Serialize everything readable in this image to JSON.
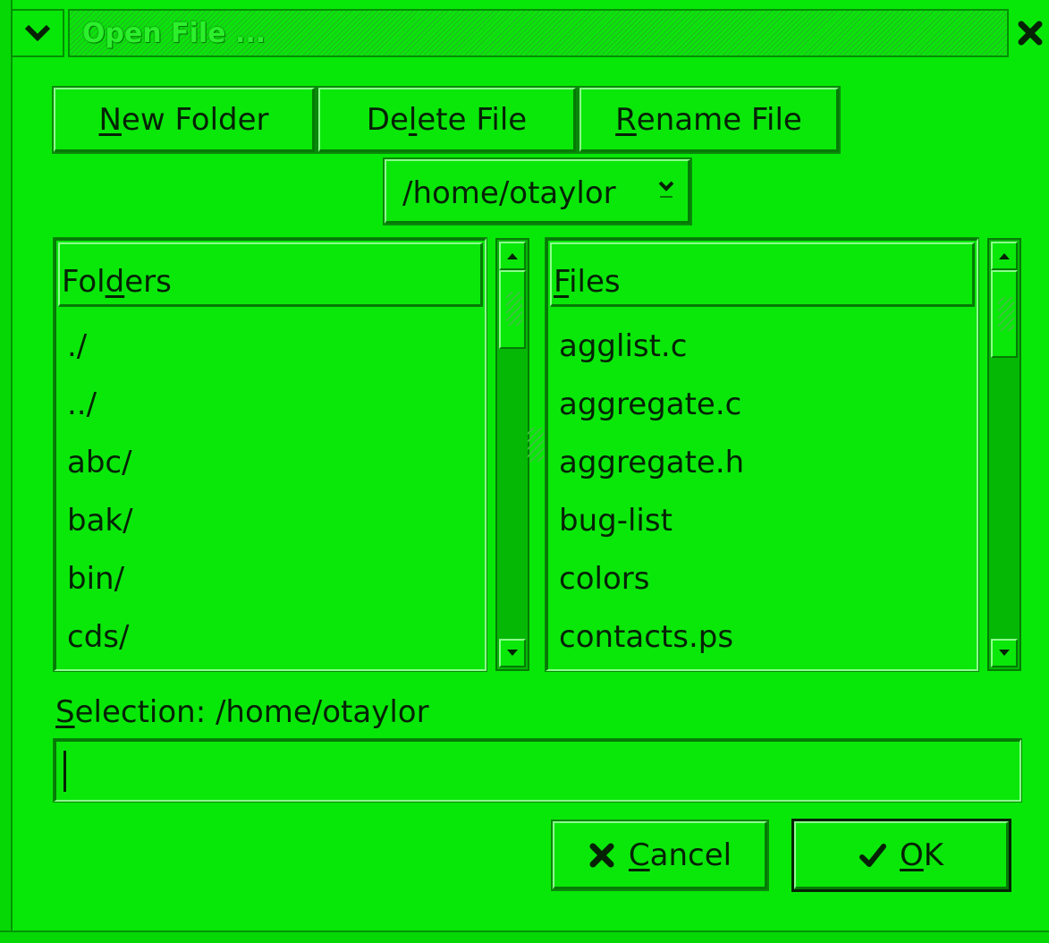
{
  "window": {
    "title": "Open File ...",
    "menu_icon": "chevron-down-icon",
    "close_icon": "close-x-icon"
  },
  "toolbar": {
    "new_folder_underline": "N",
    "new_folder_rest": "ew Folder",
    "delete_file_pre": "De",
    "delete_file_underline": "l",
    "delete_file_rest": "ete File",
    "rename_file_underline": "R",
    "rename_file_rest": "ename File"
  },
  "path": {
    "current": "/home/otaylor"
  },
  "folders": {
    "header_pre": "Fol",
    "header_underline": "d",
    "header_rest": "ers",
    "items": [
      "./",
      "../",
      "abc/",
      "bak/",
      "bin/",
      "cds/"
    ]
  },
  "files": {
    "header_underline": "F",
    "header_rest": "iles",
    "items": [
      "agglist.c",
      "aggregate.c",
      "aggregate.h",
      "bug-list",
      "colors",
      "contacts.ps"
    ]
  },
  "selection": {
    "label_underline": "S",
    "label_rest": "election: /home/otaylor",
    "value": ""
  },
  "actions": {
    "cancel_underline": "C",
    "cancel_rest": "ancel",
    "ok_underline": "O",
    "ok_rest": "K"
  },
  "colors": {
    "background": "#0ae80a",
    "text": "#052205",
    "shadow": "#057a05",
    "highlight": "#8cff8c"
  }
}
